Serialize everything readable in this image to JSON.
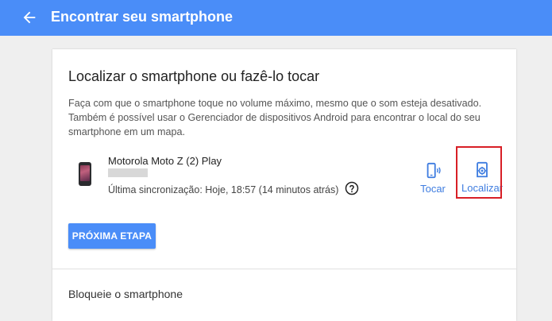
{
  "appbar": {
    "title": "Encontrar seu smartphone",
    "back_icon": "arrow-back-icon",
    "color": "#4a8df8"
  },
  "card": {
    "title": "Localizar o smartphone ou fazê-lo tocar",
    "description": "Faça com que o smartphone toque no volume máximo, mesmo que o som esteja desativado. Também é possível usar o Gerenciador de dispositivos Android para encontrar o local do seu smartphone em um mapa.",
    "device": {
      "name": "Motorola Moto Z (2) Play",
      "sync": "Última sincronização: Hoje, 18:57 (14 minutos atrás)",
      "help_icon": "help-circle-icon"
    },
    "actions": {
      "tocar": {
        "label": "Tocar",
        "icon": "phone-ring-icon"
      },
      "localizar": {
        "label": "Localizar",
        "icon": "locate-icon"
      }
    },
    "next_button": "PRÓXIMA ETAPA",
    "accent_color": "#3f7de0",
    "highlight_color": "#d81f26"
  },
  "section2": {
    "title": "Bloqueie o smartphone"
  }
}
